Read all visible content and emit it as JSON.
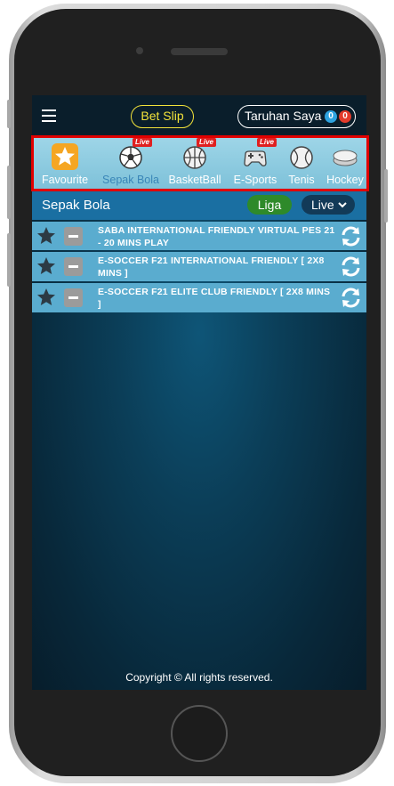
{
  "header": {
    "bet_slip_label": "Bet Slip",
    "taruhan_label": "Taruhan Saya",
    "badge_blue": "0",
    "badge_red": "0"
  },
  "sports": [
    {
      "label": "Favourite",
      "icon": "star-icon",
      "live": false
    },
    {
      "label": "Sepak Bola",
      "icon": "soccer-ball-icon",
      "live": true
    },
    {
      "label": "BasketBall",
      "icon": "basketball-icon",
      "live": true
    },
    {
      "label": "E-Sports",
      "icon": "gamepad-icon",
      "live": true
    },
    {
      "label": "Tenis",
      "icon": "tennis-ball-icon",
      "live": false
    },
    {
      "label": "Hockey",
      "icon": "hockey-puck-icon",
      "live": false
    }
  ],
  "live_tag": "Live",
  "section": {
    "title": "Sepak Bola",
    "liga_label": "Liga",
    "live_dropdown_label": "Live"
  },
  "leagues": [
    {
      "name": "SABA INTERNATIONAL FRIENDLY VIRTUAL PES 21 - 20 MINS PLAY"
    },
    {
      "name": "E-SOCCER F21 INTERNATIONAL FRIENDLY [ 2X8 MINS ]"
    },
    {
      "name": "E-SOCCER F21 ELITE CLUB FRIENDLY [ 2X8 MINS ]"
    }
  ],
  "footer": {
    "copyright": "Copyright © All rights reserved."
  },
  "colors": {
    "accent_yellow": "#f3e33a",
    "liga_green": "#2e8a2a",
    "live_red": "#e02020",
    "row_blue": "#5aaccf",
    "section_blue": "#1a6fa2"
  }
}
